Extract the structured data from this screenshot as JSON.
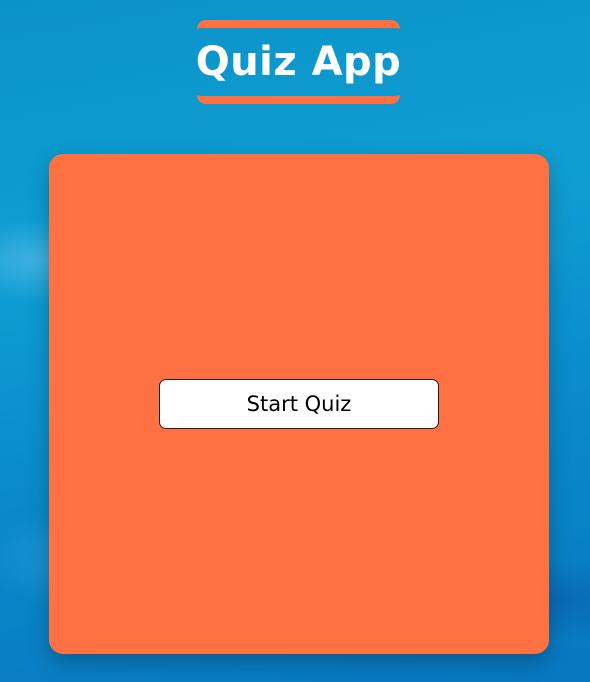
{
  "header": {
    "title": "Quiz App"
  },
  "quiz": {
    "start_label": "Start Quiz"
  },
  "colors": {
    "accent": "#ff7043",
    "background": "#0b93c9",
    "button_bg": "#ffffff"
  }
}
